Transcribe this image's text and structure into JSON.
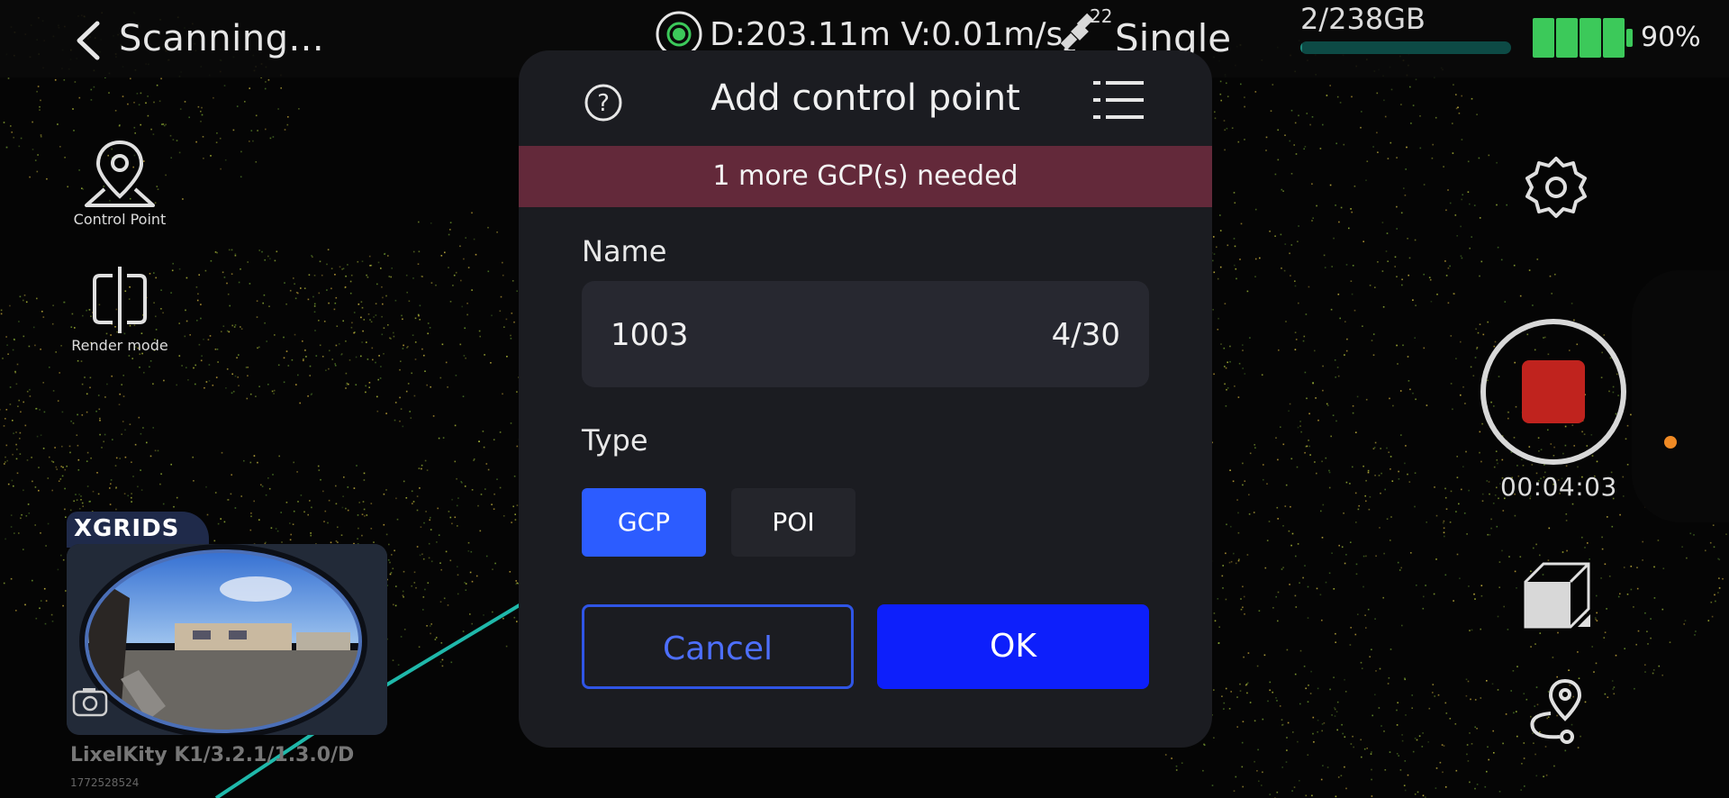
{
  "header": {
    "title": "Scanning...",
    "distance_velocity": "D:203.11m V:0.01m/s",
    "satellite_count": "22",
    "rtk_status": "Single",
    "storage": "2/238GB",
    "storage_used_fraction": 0.01,
    "battery_percent": "90%",
    "battery_level": 0.9,
    "gnss_color": "#3cc95a"
  },
  "left_tools": [
    {
      "label": "Control Point",
      "icon": "location-pin-icon"
    },
    {
      "label": "Render mode",
      "icon": "split-view-icon"
    }
  ],
  "camera": {
    "brand": "XGRIDS",
    "device": "LixelKity K1/3.2.1/1.3.0/D",
    "serial": "1772528524"
  },
  "recording": {
    "timer": "00:04:03",
    "stop_color": "#c0231e"
  },
  "right_tools": [
    {
      "icon": "gear-icon"
    },
    {
      "icon": "cube-icon"
    },
    {
      "icon": "route-pin-icon"
    }
  ],
  "dialog": {
    "title": "Add control point",
    "warning": "1 more GCP(s) needed",
    "name_label": "Name",
    "name_value": "1003",
    "name_counter": "4/30",
    "type_label": "Type",
    "types": [
      "GCP",
      "POI"
    ],
    "selected_type": "GCP",
    "cancel_label": "Cancel",
    "ok_label": "OK",
    "accent": "#0d1ffb"
  }
}
